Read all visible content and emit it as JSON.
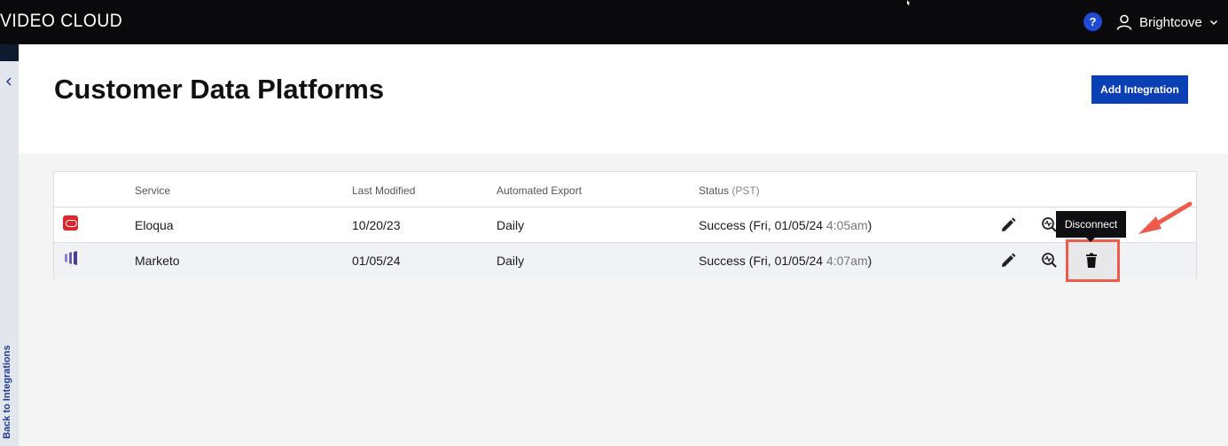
{
  "header": {
    "brand": "VIDEO CLOUD",
    "help_label": "?",
    "user_name": "Brightcove"
  },
  "sidebar": {
    "back_label": "Back to Integrations"
  },
  "page": {
    "title": "Customer Data Platforms",
    "add_button_label": "Add Integration"
  },
  "table": {
    "columns": {
      "service": "Service",
      "last_modified": "Last Modified",
      "automated_export": "Automated Export",
      "status": "Status",
      "status_tz": "(PST)"
    },
    "rows": [
      {
        "service": "Eloqua",
        "logo": "eloqua-logo",
        "last_modified": "10/20/23",
        "automated_export": "Daily",
        "status": "Success (Fri, 01/05/24",
        "status_time": "4:05am",
        "status_close": ")"
      },
      {
        "service": "Marketo",
        "logo": "marketo-logo",
        "last_modified": "01/05/24",
        "automated_export": "Daily",
        "status": "Success (Fri, 01/05/24",
        "status_time": "4:07am",
        "status_close": ")"
      }
    ]
  },
  "tooltip": {
    "label": "Disconnect"
  },
  "colors": {
    "topbar": "#0a0a0d",
    "primary_button": "#0b3fb5",
    "highlight": "#ee5b4a",
    "eloqua_red": "#e0252d",
    "marketo_purple": "#5c4c9f"
  }
}
